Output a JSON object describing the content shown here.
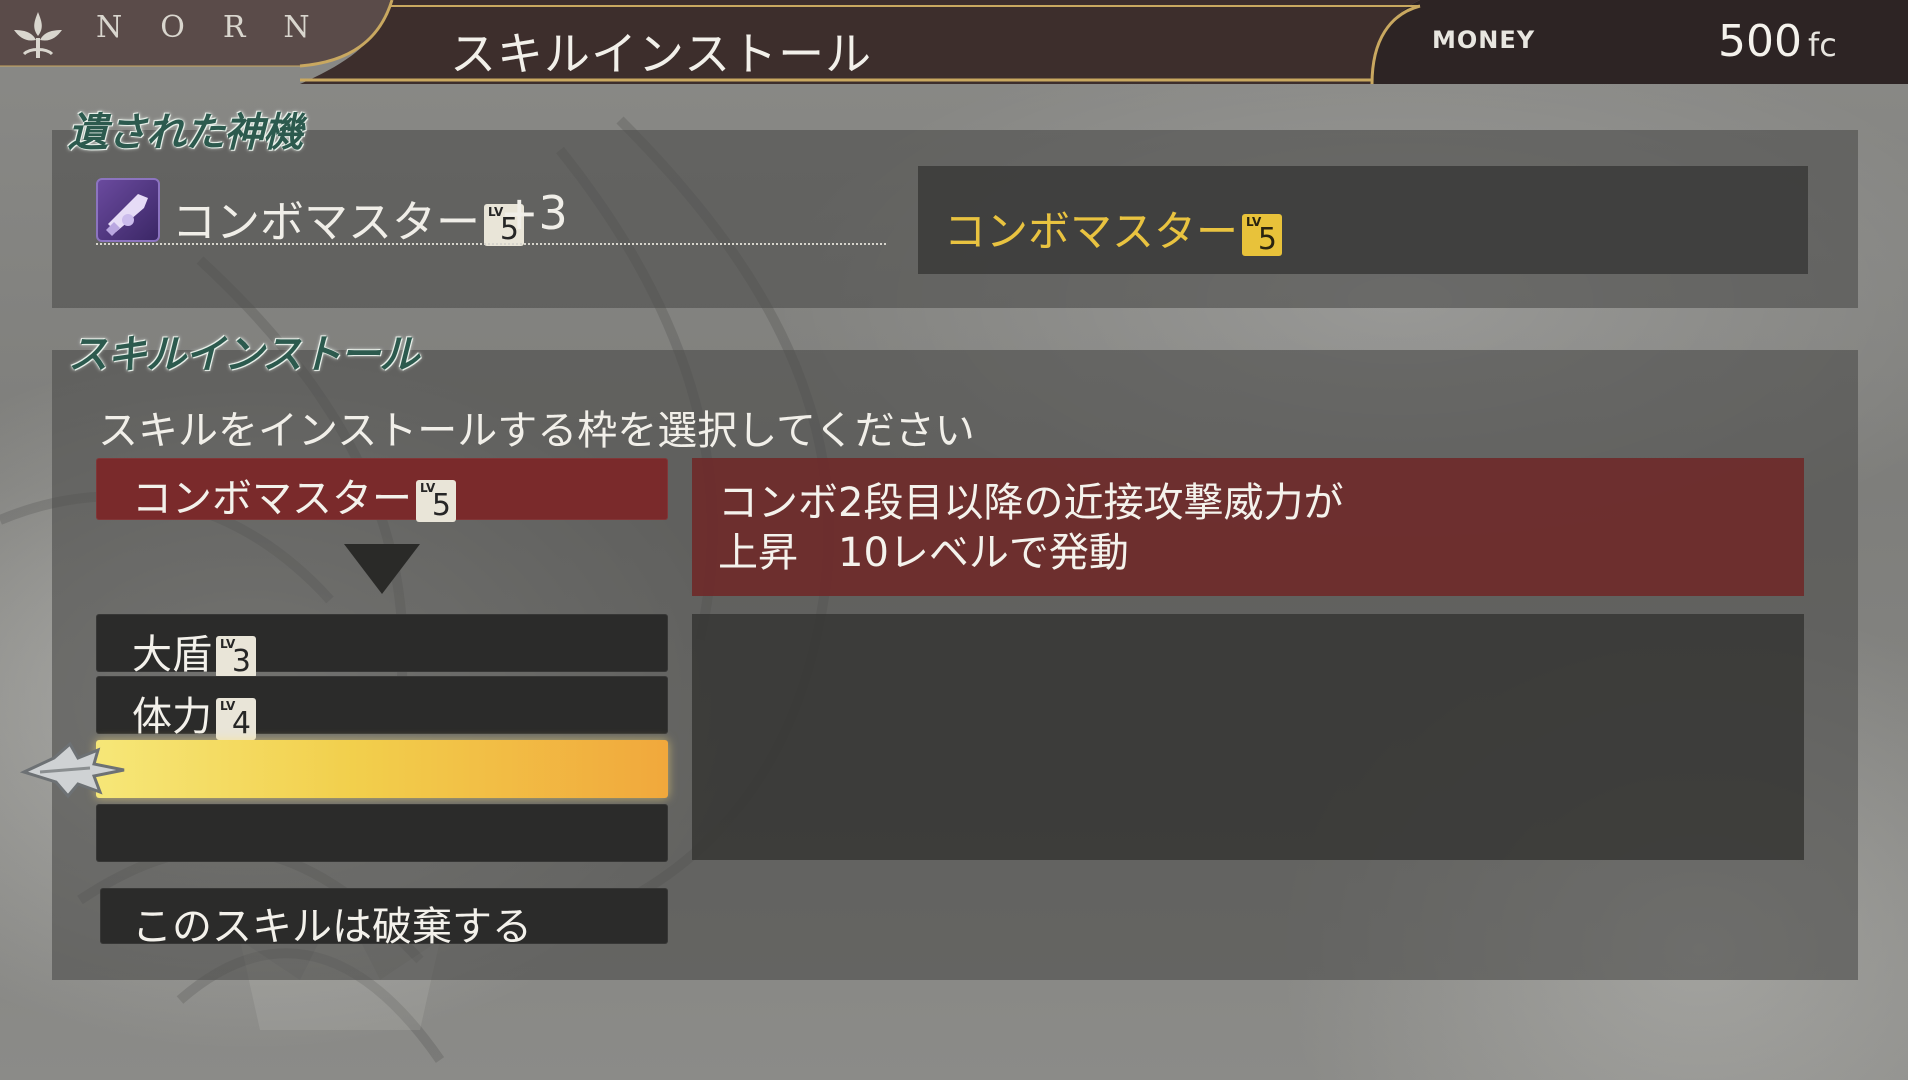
{
  "header": {
    "brand": "NORN",
    "title": "スキルインストール",
    "money_label": "MONEY",
    "money_value": "500",
    "money_unit": "fc"
  },
  "relic_section": {
    "heading": "遺された神機",
    "item": {
      "name": "コンボマスター",
      "level_label": "LV",
      "level": "5",
      "bonus": "+3",
      "icon": "relic-weapon-icon"
    },
    "preview": {
      "name": "コンボマスター",
      "level_label": "LV",
      "level": "5"
    }
  },
  "install_section": {
    "heading": "スキルインストール",
    "instruction": "スキルをインストールする枠を選択してください",
    "new_skill": {
      "name": "コンボマスター",
      "level_label": "LV",
      "level": "5",
      "description": "コンボ2段目以降の近接攻撃威力が\n上昇　10レベルで発動"
    },
    "slots": [
      {
        "name": "大盾",
        "level_label": "LV",
        "level": "3"
      },
      {
        "name": "体力",
        "level_label": "LV",
        "level": "4"
      },
      {
        "name": "",
        "selected": true
      },
      {
        "name": ""
      }
    ],
    "discard_label": "このスキルは破棄する"
  },
  "colors": {
    "header_bg": "#3a2c2a",
    "gold_trim": "#c9a860",
    "heading_green": "#2c5a4e",
    "new_skill_red": "#7a2a2b",
    "selected_gold": "#f2cf4c",
    "preview_text": "#e9c340"
  }
}
